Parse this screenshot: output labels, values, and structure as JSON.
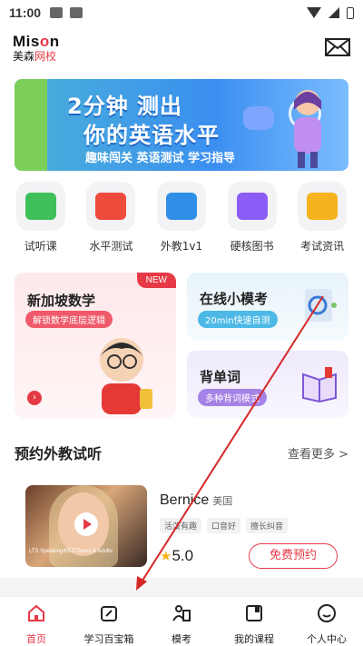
{
  "status_bar": {
    "time": "11:00"
  },
  "header": {
    "logo_en_prefix": "Mis",
    "logo_en_o": "o",
    "logo_en_suffix": "n",
    "logo_cn_black": "美森",
    "logo_cn_red": "网校",
    "mail_icon": "mail-icon"
  },
  "banner": {
    "line1": "2分钟 测出",
    "line2": "你的英语水平",
    "subtitle": "趣味闯关 英语测试 学习指导"
  },
  "quick_icons": [
    {
      "label": "试听课",
      "icon": "trial-class-icon",
      "color": "#3fbf5a"
    },
    {
      "label": "水平测试",
      "icon": "level-test-icon",
      "color": "#ef4b3c"
    },
    {
      "label": "外教1v1",
      "icon": "tutor-icon",
      "color": "#2f8fe6"
    },
    {
      "label": "硬核图书",
      "icon": "books-icon",
      "color": "#8b5cf6"
    },
    {
      "label": "考试资讯",
      "icon": "news-icon",
      "color": "#f5b31e"
    }
  ],
  "cards": {
    "singapore": {
      "badge": "NEW",
      "title": "新加坡数学",
      "subtitle": "解锁数学底层逻辑"
    },
    "mock_exam": {
      "title": "在线小模考",
      "subtitle": "20min快速自测"
    },
    "vocab": {
      "title": "背单词",
      "subtitle": "多种背词模式"
    }
  },
  "section": {
    "title": "预约外教试听",
    "more": "查看更多 >"
  },
  "teacher": {
    "name": "Bernice",
    "country": "美国",
    "tags": [
      "活泼有趣",
      "口音好",
      "擅长纠音"
    ],
    "rating": "5.0",
    "button": "免费预约",
    "photo_caption": "LTS Speaking/KET/Teens & Adults"
  },
  "tabs": [
    {
      "label": "首页",
      "icon": "home-icon",
      "active": true
    },
    {
      "label": "学习百宝箱",
      "icon": "toolbox-icon",
      "active": false
    },
    {
      "label": "模考",
      "icon": "mock-exam-icon",
      "active": false
    },
    {
      "label": "我的课程",
      "icon": "my-courses-icon",
      "active": false
    },
    {
      "label": "个人中心",
      "icon": "profile-icon",
      "active": false
    }
  ],
  "colors": {
    "brand_red": "#e63946",
    "banner_blue": "#3b8ff0"
  }
}
